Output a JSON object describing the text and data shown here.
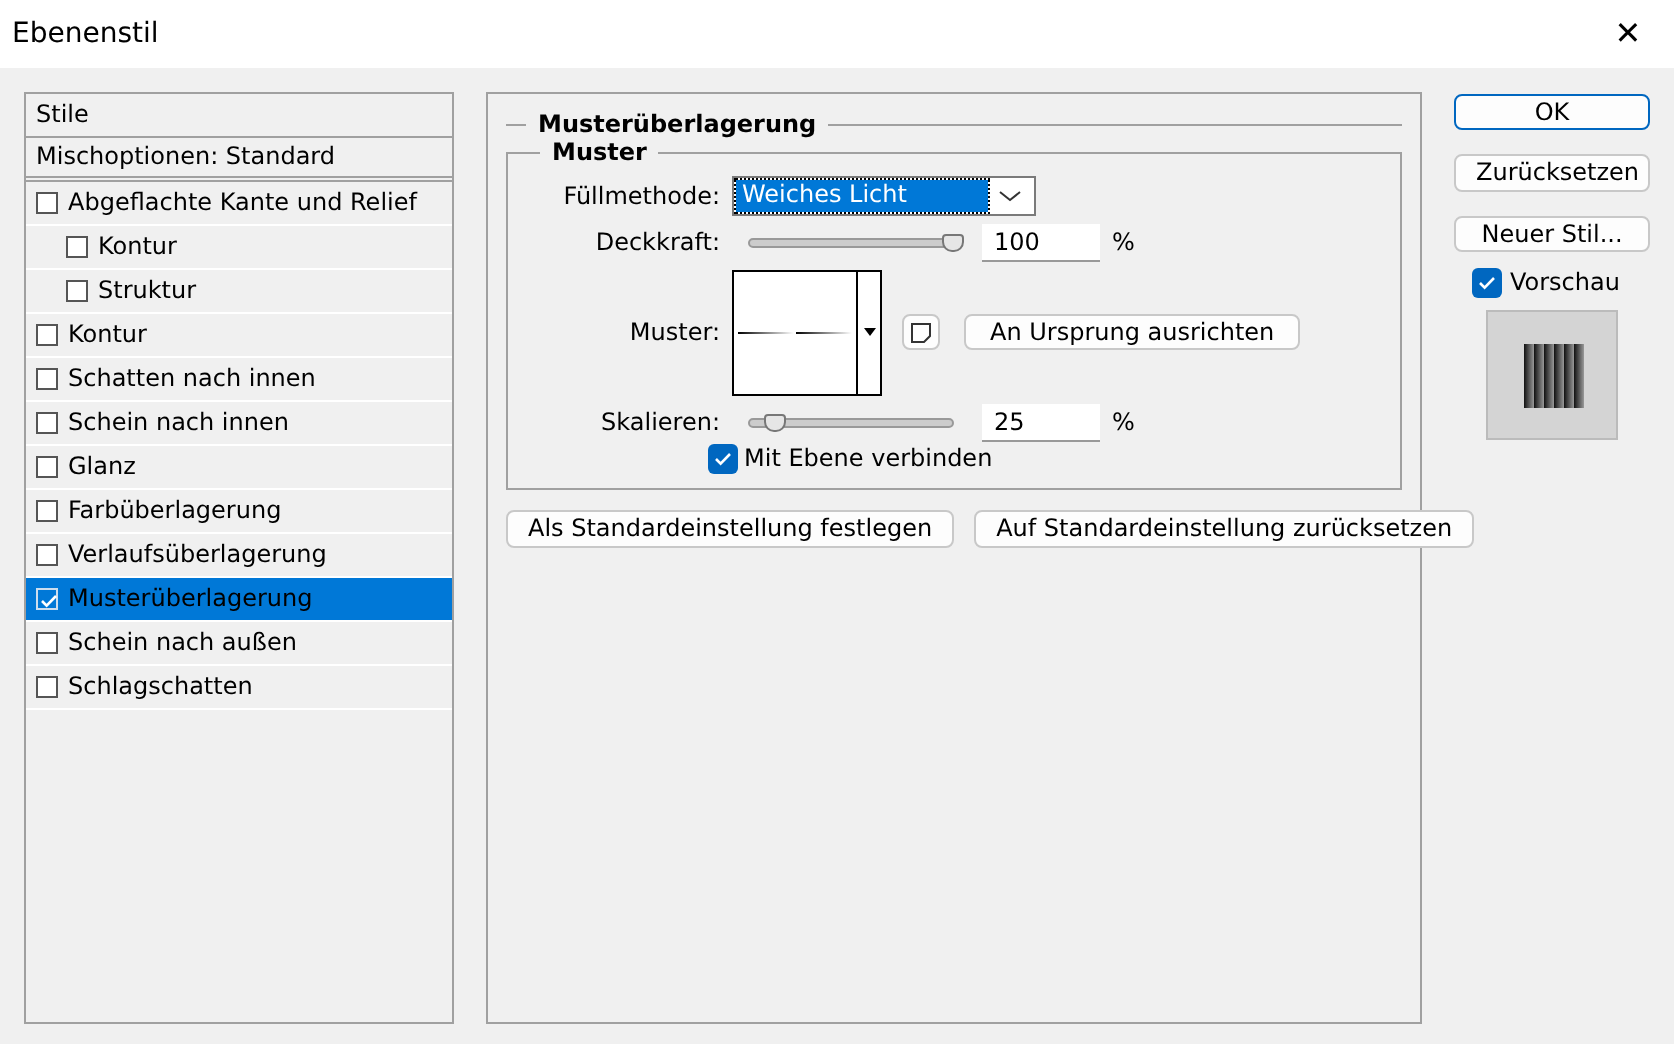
{
  "window": {
    "title": "Ebenenstil",
    "close": "✕"
  },
  "sidebar": {
    "header": "Stile",
    "blend_options": "Mischoptionen: Standard",
    "items": [
      {
        "label": "Abgeflachte Kante und Relief",
        "checked": false,
        "selected": false,
        "children": [
          {
            "label": "Kontur",
            "checked": false,
            "selected": false
          },
          {
            "label": "Struktur",
            "checked": false,
            "selected": false
          }
        ]
      },
      {
        "label": "Kontur",
        "checked": false,
        "selected": false
      },
      {
        "label": "Schatten nach innen",
        "checked": false,
        "selected": false
      },
      {
        "label": "Schein nach innen",
        "checked": false,
        "selected": false
      },
      {
        "label": "Glanz",
        "checked": false,
        "selected": false
      },
      {
        "label": "Farbüberlagerung",
        "checked": false,
        "selected": false
      },
      {
        "label": "Verlaufsüberlagerung",
        "checked": false,
        "selected": false
      },
      {
        "label": "Musterüberlagerung",
        "checked": true,
        "selected": true
      },
      {
        "label": "Schein nach außen",
        "checked": false,
        "selected": false
      },
      {
        "label": "Schlagschatten",
        "checked": false,
        "selected": false
      }
    ]
  },
  "panel": {
    "title": "Musterüberlagerung",
    "group": "Muster",
    "blend_mode": {
      "label": "Füllmethode:",
      "value": "Weiches Licht"
    },
    "opacity": {
      "label": "Deckkraft:",
      "level": 1.0,
      "value": "100",
      "unit": "%"
    },
    "pattern": {
      "label": "Muster:",
      "snap_button": "An Ursprung ausrichten"
    },
    "scale": {
      "label": "Skalieren:",
      "level": 0.12,
      "value": "25",
      "unit": "%"
    },
    "link": {
      "label": "Mit Ebene verbinden",
      "checked": true
    },
    "buttons": [
      "Als Standardeinstellung festlegen",
      "Auf Standardeinstellung zurücksetzen"
    ]
  },
  "actions": {
    "buttons": [
      {
        "label": "OK",
        "kind": "default"
      },
      {
        "label": "Zurücksetzen",
        "kind": "normal"
      },
      {
        "label": "Neuer Stil...",
        "kind": "normal"
      }
    ],
    "preview": {
      "label": "Vorschau",
      "checked": true
    }
  }
}
